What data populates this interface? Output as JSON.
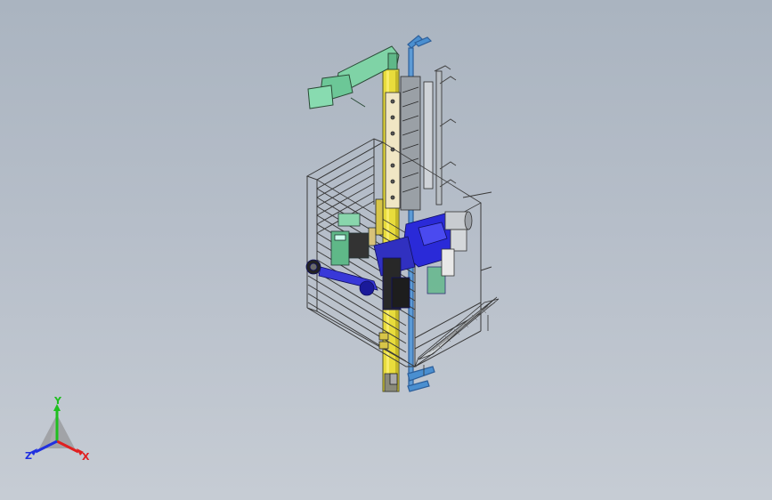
{
  "triad": {
    "x_label": "X",
    "y_label": "Y",
    "z_label": "Z"
  },
  "colors": {
    "x_axis": "#e02020",
    "y_axis": "#1fbf1f",
    "z_axis": "#2030e0",
    "column": "#e8dc3c",
    "arm_green": "#7fd3a6",
    "robot_blue": "#2a2ad8",
    "bracket_blue": "#4a8fd0",
    "cage": "#3a3a3a"
  }
}
